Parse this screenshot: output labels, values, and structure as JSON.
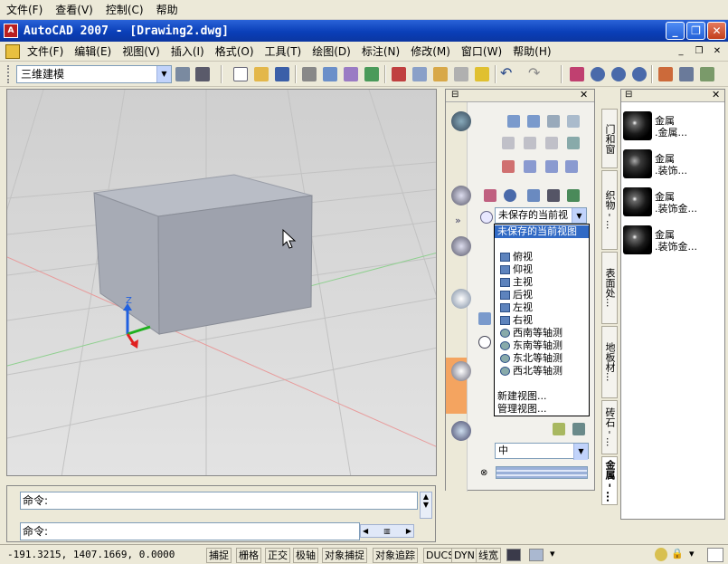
{
  "outer_menu": [
    "文件(F)",
    "查看(V)",
    "控制(C)",
    "帮助"
  ],
  "window": {
    "title": "AutoCAD 2007 - [Drawing2.dwg]",
    "minimize": "_",
    "maximize": "❐",
    "close": "✕"
  },
  "cad_menu": [
    "文件(F)",
    "编辑(E)",
    "视图(V)",
    "插入(I)",
    "格式(O)",
    "工具(T)",
    "绘图(D)",
    "标注(N)",
    "修改(M)",
    "窗口(W)",
    "帮助(H)"
  ],
  "toolbar": {
    "workspace": "三维建模"
  },
  "viewport": {
    "axis_label": "Z"
  },
  "dashboard": {
    "view_combo_value": "未保存的当前视",
    "dropdown": {
      "selected": "未保存的当前视图",
      "views": [
        "俯视",
        "仰视",
        "主视",
        "后视",
        "左视",
        "右视",
        "西南等轴测",
        "东南等轴测",
        "东北等轴测",
        "西北等轴测"
      ],
      "actions": [
        "新建视图...",
        "管理视图..."
      ]
    },
    "bottom_combo_value": "中"
  },
  "vertical_tabs": [
    "门和窗",
    "织物 - ...",
    "表面处...",
    "地板材...",
    "砖石 - ...",
    "金属 - ..."
  ],
  "materials": [
    {
      "name": "金属",
      "sub": ".金属..."
    },
    {
      "name": "金属",
      "sub": ".装饰..."
    },
    {
      "name": "金属",
      "sub": ".装饰金..."
    },
    {
      "name": "金属",
      "sub": ".装饰金..."
    }
  ],
  "command": {
    "line1": "命令:",
    "line2": "命令:"
  },
  "status": {
    "coords": "-191.3215,  1407.1669, 0.0000",
    "buttons": [
      "捕捉",
      "栅格",
      "正交",
      "极轴",
      "对象捕捉",
      "对象追踪",
      "DUCS",
      "DYN",
      "线宽"
    ]
  },
  "colors": {
    "titlebar": "#0a3fb8",
    "selection": "#316ac5",
    "accent_orange": "#f4a460"
  }
}
